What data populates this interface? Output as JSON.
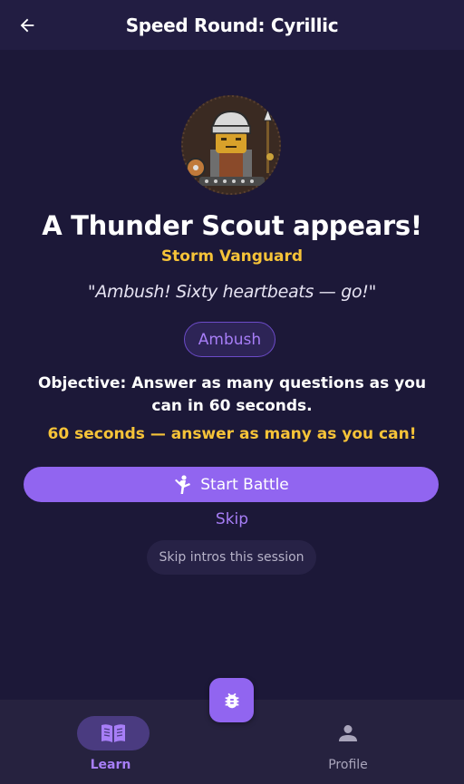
{
  "appbar": {
    "title": "Speed Round: Cyrillic",
    "back_icon": "arrow-left-icon"
  },
  "encounter": {
    "avatar_icon": "warrior-avatar",
    "heading": "A Thunder Scout appears!",
    "subtitle": "Storm Vanguard",
    "quote": "\"Ambush! Sixty heartbeats — go!\"",
    "mode_chip": "Ambush",
    "objective": "Objective: Answer as many questions as you can in 60 seconds.",
    "timer_note": "60 seconds — answer as many as you can!"
  },
  "actions": {
    "start_label": "Start Battle",
    "start_icon": "kick-icon",
    "skip_label": "Skip",
    "skip_intros_label": "Skip intros this session"
  },
  "fab": {
    "icon": "bug-icon"
  },
  "bottom_nav": {
    "items": [
      {
        "label": "Learn",
        "icon": "book-icon",
        "active": true
      },
      {
        "label": "Profile",
        "icon": "person-icon",
        "active": false
      }
    ]
  },
  "colors": {
    "background": "#1c1838",
    "appbar": "#221d42",
    "accent": "#9165f0",
    "accent_text": "#a77ef7",
    "gold": "#f6c338",
    "nav_background": "#26223f"
  }
}
